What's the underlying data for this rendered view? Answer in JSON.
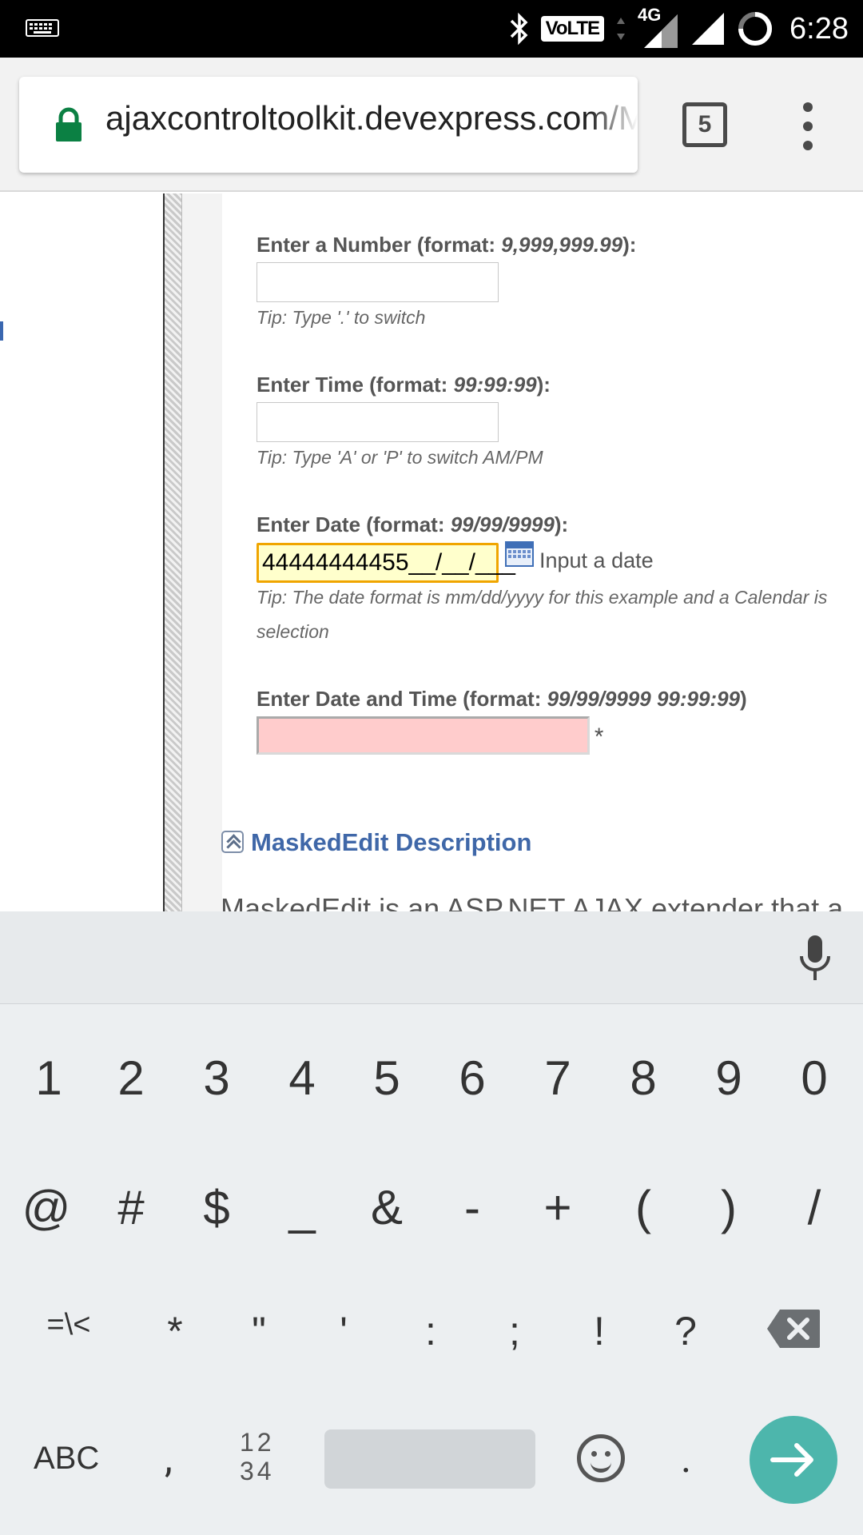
{
  "status_bar": {
    "time": "6:28",
    "volte": "VoLTE",
    "network": "4G",
    "icons": [
      "keyboard-icon",
      "bluetooth-icon",
      "signal-icon",
      "battery-icon"
    ]
  },
  "browser": {
    "url": "ajaxcontroltoolkit.devexpress.com/MaskedEdit",
    "tab_count": "5"
  },
  "form": {
    "number_label_prefix": "Enter a Number (format: ",
    "number_format": "9,999,999.99",
    "number_label_suffix": "):",
    "number_value": "",
    "number_tip": "Tip: Type '.' to switch",
    "time_label_prefix": "Enter Time (format: ",
    "time_format": "99:99:99",
    "time_label_suffix": "):",
    "time_value": "",
    "time_tip": "Tip: Type 'A' or 'P' to switch AM/PM",
    "date_label_prefix": "Enter Date (format: ",
    "date_format": "99/99/9999",
    "date_label_suffix": "):",
    "date_value": "44444444455__/__/___",
    "date_hint": "Input a date",
    "date_tip_line1": "Tip: The date format is mm/dd/yyyy for this example and a Calendar is",
    "date_tip_line2": "selection",
    "datetime_label_prefix": "Enter Date and Time (format: ",
    "datetime_format": "99/99/9999 99:99:99",
    "datetime_label_suffix": ")",
    "datetime_value": "",
    "datetime_required": "*"
  },
  "section": {
    "title": "MaskedEdit Description",
    "description": "MaskedEdit is an ASP.NET AJAX extender that a"
  },
  "keyboard": {
    "row1": [
      "1",
      "2",
      "3",
      "4",
      "5",
      "6",
      "7",
      "8",
      "9",
      "0"
    ],
    "row2": [
      "@",
      "#",
      "$",
      "_",
      "&",
      "-",
      "+",
      "(",
      ")",
      "/"
    ],
    "row3": [
      "=\\<",
      "*",
      "\"",
      "'",
      ":",
      ";",
      "!",
      "?"
    ],
    "abc": "ABC",
    "comma": ",",
    "num_top": "12",
    "num_bottom": "34",
    "period": ".",
    "accent_color": "#4db6ac"
  }
}
